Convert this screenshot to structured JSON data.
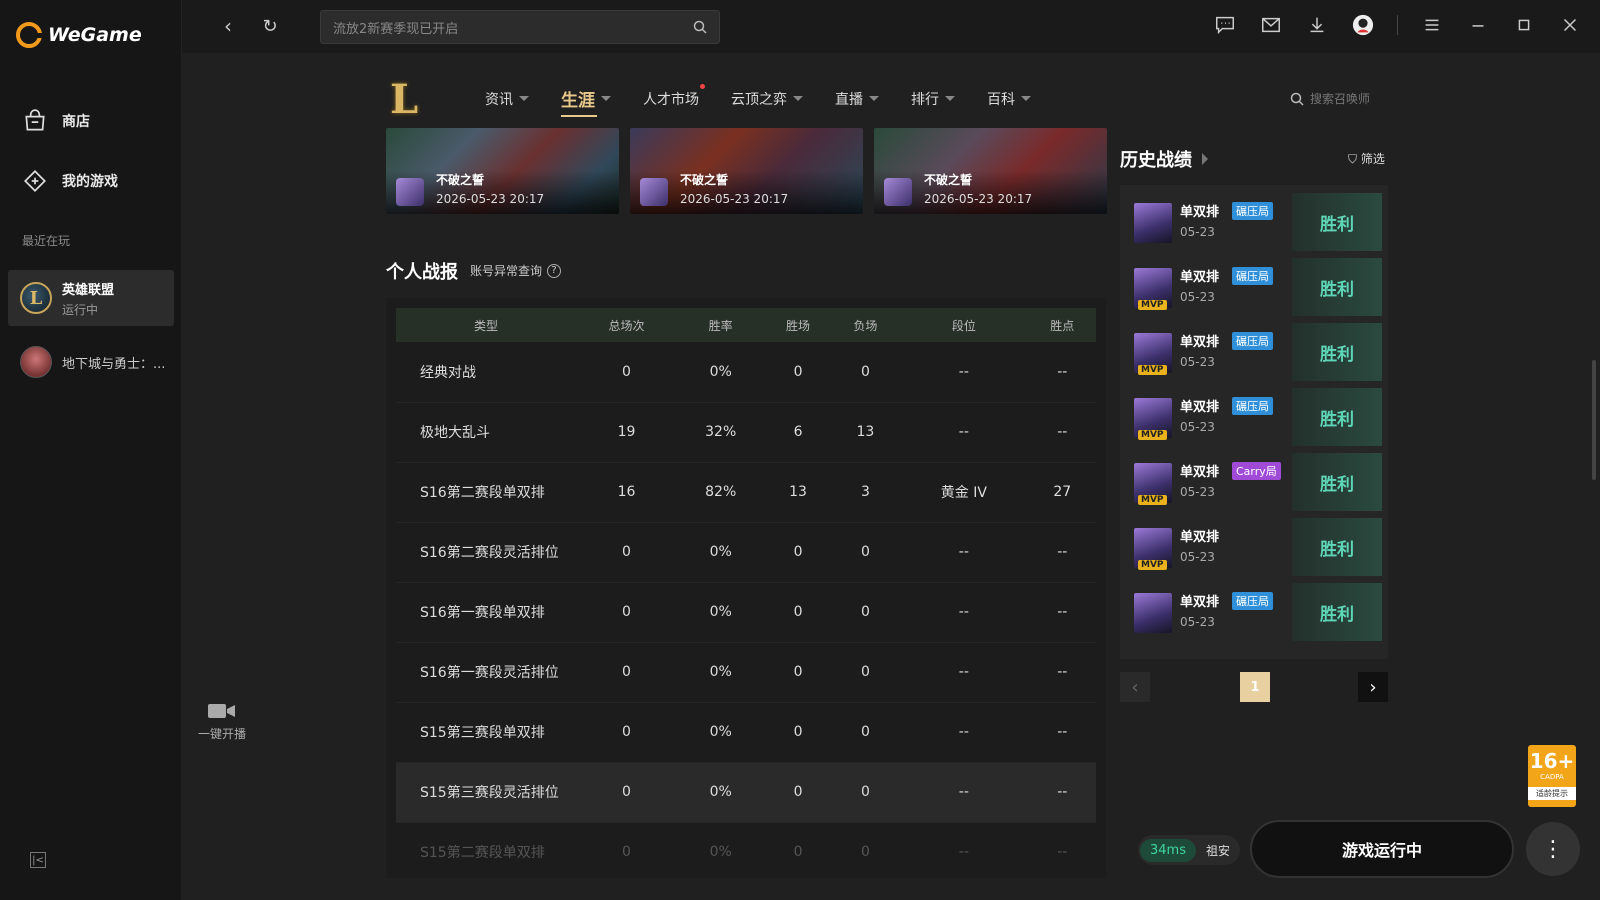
{
  "app": {
    "name": "WeGame"
  },
  "sidebar": {
    "items": [
      {
        "label": "商店",
        "icon": "store-icon"
      },
      {
        "label": "我的游戏",
        "icon": "games-icon"
      }
    ],
    "recent_label": "最近在玩",
    "recent": [
      {
        "title": "英雄联盟",
        "status": "运行中"
      },
      {
        "title": "地下城与勇士：..."
      }
    ]
  },
  "topbar": {
    "search_placeholder": "流放2新赛季现已开启"
  },
  "game_nav": {
    "tabs": [
      "资讯",
      "生涯",
      "人才市场",
      "云顶之弈",
      "直播",
      "排行",
      "百科"
    ],
    "active_tab": "生涯",
    "search_placeholder": "搜索召唤师"
  },
  "highlights": [
    {
      "title": "不破之誓",
      "time": "2026-05-23 20:17"
    },
    {
      "title": "不破之誓",
      "time": "2026-05-23 20:17"
    },
    {
      "title": "不破之誓",
      "time": "2026-05-23 20:17"
    }
  ],
  "personal": {
    "title": "个人战报",
    "link": "账号异常查询",
    "headers": [
      "类型",
      "总场次",
      "胜率",
      "胜场",
      "负场",
      "段位",
      "胜点"
    ],
    "rows": [
      [
        "经典对战",
        "0",
        "0%",
        "0",
        "0",
        "--",
        "--"
      ],
      [
        "极地大乱斗",
        "19",
        "32%",
        "6",
        "13",
        "--",
        "--"
      ],
      [
        "S16第二赛段单双排",
        "16",
        "82%",
        "13",
        "3",
        "黄金 IV",
        "27"
      ],
      [
        "S16第二赛段灵活排位",
        "0",
        "0%",
        "0",
        "0",
        "--",
        "--"
      ],
      [
        "S16第一赛段单双排",
        "0",
        "0%",
        "0",
        "0",
        "--",
        "--"
      ],
      [
        "S16第一赛段灵活排位",
        "0",
        "0%",
        "0",
        "0",
        "--",
        "--"
      ],
      [
        "S15第三赛段单双排",
        "0",
        "0%",
        "0",
        "0",
        "--",
        "--"
      ],
      [
        "S15第三赛段灵活排位",
        "0",
        "0%",
        "0",
        "0",
        "--",
        "--"
      ],
      [
        "S15第二赛段单双排",
        "0",
        "0%",
        "0",
        "0",
        "--",
        "--"
      ]
    ]
  },
  "record_button": "一键开播",
  "history": {
    "title": "历史战绩",
    "filter": "筛选",
    "matches": [
      {
        "mode": "单双排",
        "tag": "碾压局",
        "tag_color": "blue",
        "date": "05-23",
        "result": "胜利",
        "mvp": false
      },
      {
        "mode": "单双排",
        "tag": "碾压局",
        "tag_color": "blue",
        "date": "05-23",
        "result": "胜利",
        "mvp": true
      },
      {
        "mode": "单双排",
        "tag": "碾压局",
        "tag_color": "blue",
        "date": "05-23",
        "result": "胜利",
        "mvp": true
      },
      {
        "mode": "单双排",
        "tag": "碾压局",
        "tag_color": "blue",
        "date": "05-23",
        "result": "胜利",
        "mvp": true
      },
      {
        "mode": "单双排",
        "tag": "Carry局",
        "tag_color": "purple",
        "date": "05-23",
        "result": "胜利",
        "mvp": true
      },
      {
        "mode": "单双排",
        "tag": "",
        "tag_color": "",
        "date": "05-23",
        "result": "胜利",
        "mvp": true
      },
      {
        "mode": "单双排",
        "tag": "碾压局",
        "tag_color": "blue",
        "date": "05-23",
        "result": "胜利",
        "mvp": false
      }
    ],
    "page": "1",
    "mvp_label": "MVP"
  },
  "status": {
    "ping": "34ms",
    "server": "祖安",
    "play_button": "游戏运行中"
  },
  "age_badge": {
    "rating": "16+",
    "sub": "CADPA",
    "tip": "适龄提示"
  }
}
